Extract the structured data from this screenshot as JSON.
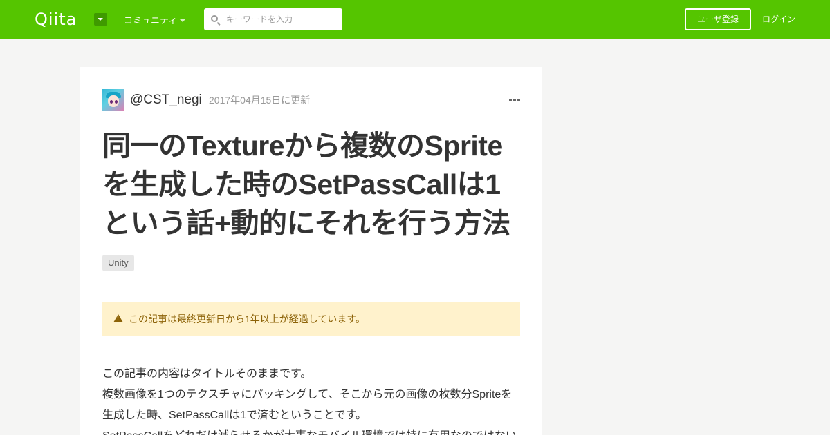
{
  "header": {
    "logo_text": "Qiita",
    "community_label": "コミュニティ",
    "search_placeholder": "キーワードを入力",
    "signup_label": "ユーザ登録",
    "login_label": "ログイン"
  },
  "article": {
    "author": "@CST_negi",
    "updated": "2017年04月15日に更新",
    "more_label": "•••",
    "title": "同一のTextureから複数のSpriteを生成した時のSetPassCallは1という話+動的にそれを行う方法",
    "tag": "Unity",
    "notice": "この記事は最終更新日から1年以上が経過しています。",
    "body": {
      "line1": "この記事の内容はタイトルそのままです。",
      "line2": "複数画像を1つのテクスチャにパッキングして、そこから元の画像の枚数分Spriteを",
      "line3": "生成した時、SetPassCallは1で済むということです。",
      "line4": "SetPassCallをどれだけ減らせるかが大事なモバイル環境では特に有用なのではない"
    }
  },
  "colors": {
    "brand": "#55c500",
    "background": "#f5f5f4",
    "notice_bg": "#fff2cc",
    "notice_text": "#8c6207"
  },
  "icons": [
    "logo-dropdown-icon",
    "chevron-down-icon",
    "search-icon",
    "avatar",
    "more-icon",
    "warning-icon"
  ]
}
